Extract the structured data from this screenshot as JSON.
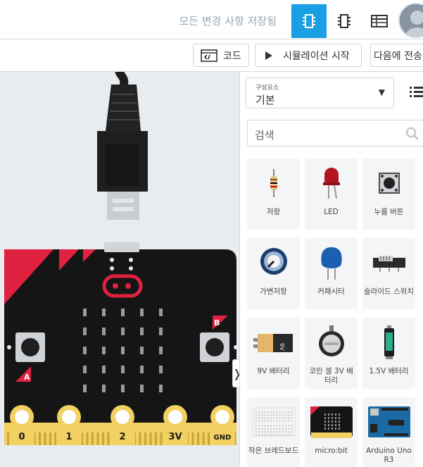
{
  "header": {
    "save_status": "모든 변경 사항 저장됨",
    "view_buttons": [
      "circuit-view-icon",
      "component-view-icon",
      "schematic-list-icon"
    ],
    "accent_color": "#1a9fe4"
  },
  "toolbar": {
    "code_label": "코드",
    "simulate_label": "시뮬레이션 시작",
    "send_label": "다음에 전송"
  },
  "board": {
    "pins": [
      "0",
      "1",
      "2",
      "3V",
      "GND"
    ],
    "button_a": "A",
    "button_b": "B"
  },
  "panel": {
    "select_caption": "구성요소",
    "select_value": "기본",
    "search_placeholder": "검색",
    "components": [
      {
        "label": "저항",
        "icon": "resistor-icon"
      },
      {
        "label": "LED",
        "icon": "led-icon"
      },
      {
        "label": "누름 버튼",
        "icon": "pushbutton-icon"
      },
      {
        "label": "가변저항",
        "icon": "potentiometer-icon"
      },
      {
        "label": "커패시터",
        "icon": "capacitor-icon"
      },
      {
        "label": "슬라이드 스위치",
        "icon": "slide-switch-icon"
      },
      {
        "label": "9V 배터리",
        "icon": "battery-9v-icon"
      },
      {
        "label": "코인 셀 3V 배터리",
        "icon": "coin-cell-icon"
      },
      {
        "label": "1.5V 배터리",
        "icon": "battery-aa-icon"
      },
      {
        "label": "작은 브레드보드",
        "icon": "breadboard-icon"
      },
      {
        "label": "micro:bit",
        "icon": "microbit-icon"
      },
      {
        "label": "Arduino Uno R3",
        "icon": "arduino-icon"
      }
    ]
  }
}
